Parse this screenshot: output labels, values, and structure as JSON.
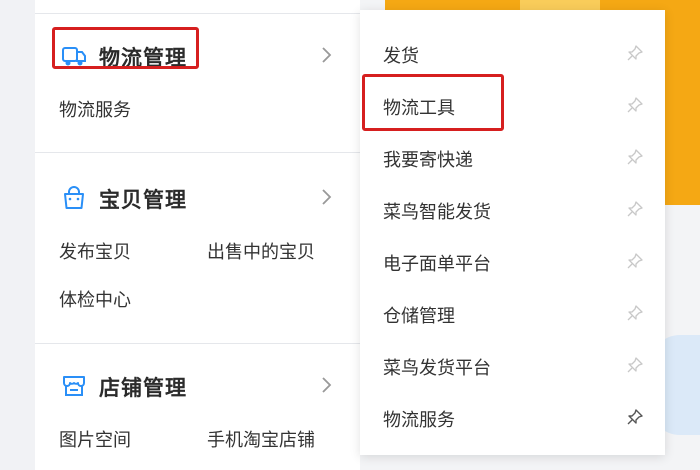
{
  "colors": {
    "accent_blue": "#2a8ff7",
    "highlight_red": "#d61f1f",
    "banner_yellow": "#f5a814"
  },
  "sidebar": {
    "sections": [
      {
        "title": "物流管理",
        "icon": "truck-icon",
        "links": [
          "物流服务"
        ]
      },
      {
        "title": "宝贝管理",
        "icon": "bag-icon",
        "links": [
          "发布宝贝",
          "出售中的宝贝",
          "体检中心"
        ]
      },
      {
        "title": "店铺管理",
        "icon": "shop-icon",
        "links": [
          "图片空间",
          "手机淘宝店铺"
        ]
      }
    ]
  },
  "flyout": {
    "items": [
      {
        "label": "发货",
        "pinned": false
      },
      {
        "label": "物流工具",
        "pinned": false
      },
      {
        "label": "我要寄快递",
        "pinned": false
      },
      {
        "label": "菜鸟智能发货",
        "pinned": false
      },
      {
        "label": "电子面单平台",
        "pinned": false
      },
      {
        "label": "仓储管理",
        "pinned": false
      },
      {
        "label": "菜鸟发货平台",
        "pinned": false
      },
      {
        "label": "物流服务",
        "pinned": true
      }
    ]
  }
}
